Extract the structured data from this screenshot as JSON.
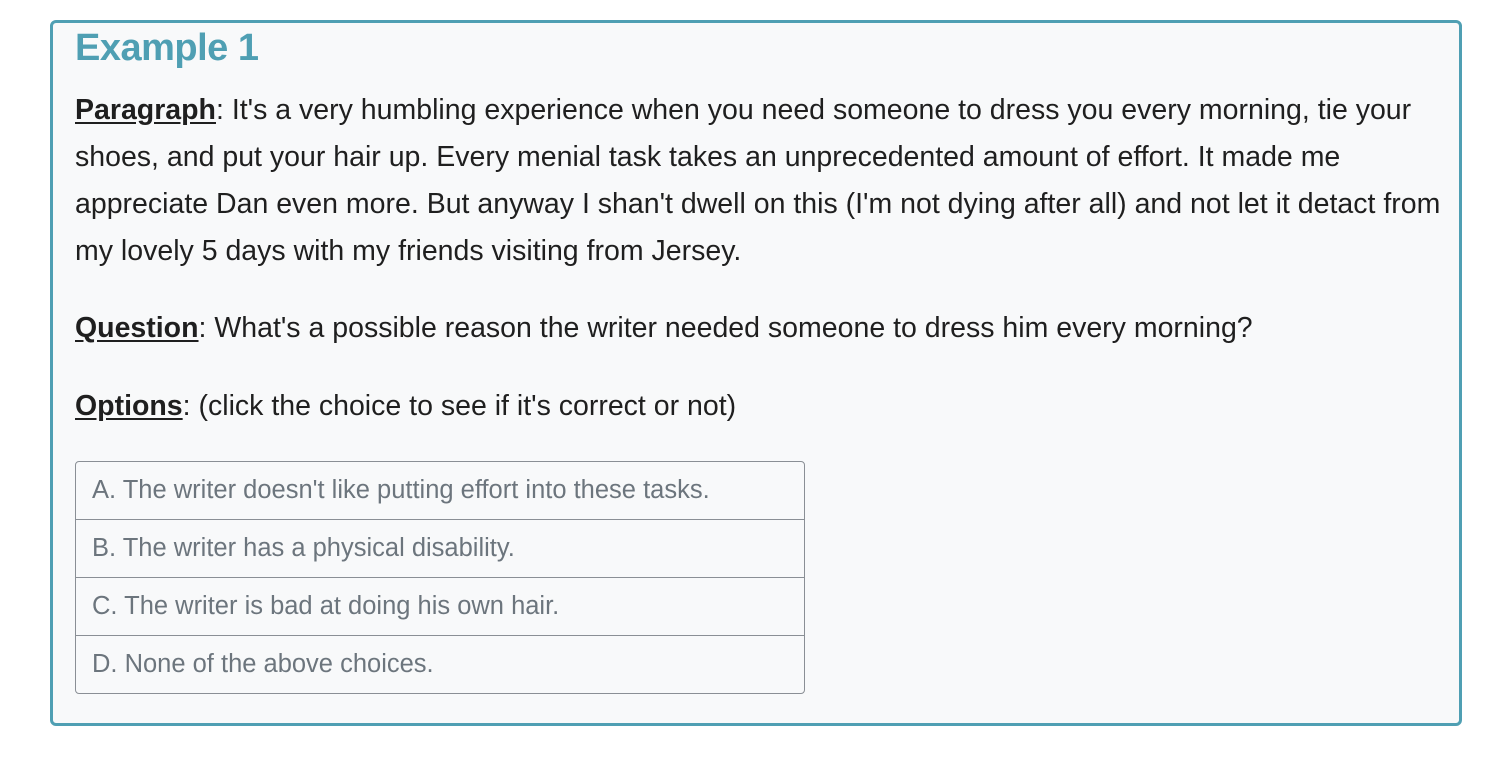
{
  "example": {
    "title": "Example 1",
    "paragraph_label": "Paragraph",
    "paragraph_text": ": It's a very humbling experience when you need someone to dress you every morning, tie your shoes, and put your hair up. Every menial task takes an unprecedented amount of effort. It made me appreciate Dan even more. But anyway I shan't dwell on this (I'm not dying after all) and not let it detact from my lovely 5 days with my friends visiting from Jersey.",
    "question_label": "Question",
    "question_text": ": What's a possible reason the writer needed someone to dress him every morning?",
    "options_label": "Options",
    "options_hint": ": (click the choice to see if it's correct or not)",
    "options": [
      "A. The writer doesn't like putting effort into these tasks.",
      "B. The writer has a physical disability.",
      "C. The writer is bad at doing his own hair.",
      "D. None of the above choices."
    ]
  },
  "colors": {
    "accent": "#4f9fb3",
    "card_background": "#f8f9fa",
    "option_text": "#6c757d",
    "body_text": "#1f1f1f"
  }
}
